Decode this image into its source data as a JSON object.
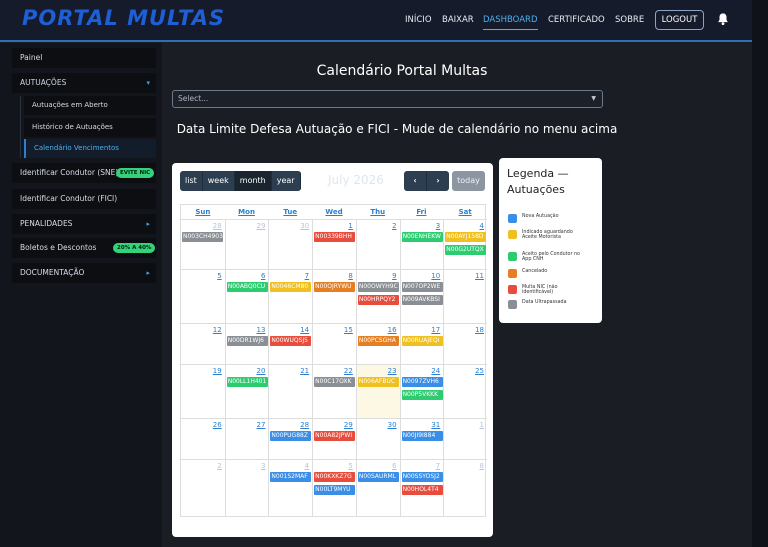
{
  "brand": {
    "logo": "PORTAL MULTAS"
  },
  "nav": {
    "items": [
      "INÍCIO",
      "BAIXAR",
      "DASHBOARD",
      "CERTIFICADO",
      "SOBRE"
    ],
    "logout": "LOGOUT"
  },
  "sidebar": {
    "painel": "Painel",
    "autuacoes": "AUTUAÇÕES",
    "sub": [
      "Autuações em Aberto",
      "Histórico de Autuações",
      "Calendário Vencimentos"
    ],
    "identificar_sne": "Identificar Condutor (SNE)",
    "badge_sne": "EVITE NIC",
    "identificar_fici": "Identificar Condutor (FICI)",
    "penalidades": "PENALIDADES",
    "boletos": "Boletos e Descontos",
    "badge_boletos": "20% A 40%",
    "documentacao": "DOCUMENTAÇÃO"
  },
  "main": {
    "title": "Calendário Portal Multas",
    "select_placeholder": "Select...",
    "subtitle": "Data Limite Defesa Autuação e FICI - Mude de calendário no menu acima"
  },
  "calendar": {
    "views": [
      "list",
      "week",
      "month",
      "year"
    ],
    "active_view": "month",
    "title": "July 2026",
    "today_label": "today",
    "dow": [
      "Sun",
      "Mon",
      "Tue",
      "Wed",
      "Thu",
      "Fri",
      "Sat"
    ],
    "weeks": [
      [
        "28",
        "29",
        "30",
        "1",
        "2",
        "3",
        "4"
      ],
      [
        "5",
        "6",
        "7",
        "8",
        "9",
        "10",
        "11"
      ],
      [
        "12",
        "13",
        "14",
        "15",
        "16",
        "17",
        "18"
      ],
      [
        "19",
        "20",
        "21",
        "22",
        "23",
        "24",
        "25"
      ],
      [
        "26",
        "27",
        "28",
        "29",
        "30",
        "31",
        "1"
      ],
      [
        "2",
        "3",
        "4",
        "5",
        "6",
        "7",
        "8"
      ]
    ],
    "events": [
      {
        "w": 0,
        "d": 0,
        "slot": 0,
        "label": "N003CH4903",
        "color": "gray"
      },
      {
        "w": 0,
        "d": 3,
        "slot": 0,
        "label": "N00339BHH",
        "color": "red"
      },
      {
        "w": 0,
        "d": 5,
        "slot": 0,
        "label": "N00ENHEKW",
        "color": "green"
      },
      {
        "w": 0,
        "d": 6,
        "slot": 0,
        "label": "N00AYJ158D",
        "color": "yellow"
      },
      {
        "w": 0,
        "d": 6,
        "slot": 1,
        "label": "N00G2UTQX",
        "color": "green"
      },
      {
        "w": 1,
        "d": 1,
        "slot": 0,
        "label": "N00ABQ0CU",
        "color": "green"
      },
      {
        "w": 1,
        "d": 2,
        "slot": 0,
        "label": "N0046CM80",
        "color": "yellow"
      },
      {
        "w": 1,
        "d": 3,
        "slot": 0,
        "label": "N00OJRYWU",
        "color": "orange"
      },
      {
        "w": 1,
        "d": 4,
        "slot": 0,
        "label": "N00OWYH9C",
        "color": "gray"
      },
      {
        "w": 1,
        "d": 4,
        "slot": 1,
        "label": "N00HRPQY2",
        "color": "red"
      },
      {
        "w": 1,
        "d": 5,
        "slot": 0,
        "label": "N007OP2WE",
        "color": "gray"
      },
      {
        "w": 1,
        "d": 5,
        "slot": 1,
        "label": "N009AVKBSI",
        "color": "gray"
      },
      {
        "w": 2,
        "d": 1,
        "slot": 0,
        "label": "N00DR1WJ6",
        "color": "gray"
      },
      {
        "w": 2,
        "d": 2,
        "slot": 0,
        "label": "N00WUQSJ5",
        "color": "red"
      },
      {
        "w": 2,
        "d": 4,
        "slot": 0,
        "label": "N00PCSGHA",
        "color": "orange"
      },
      {
        "w": 2,
        "d": 5,
        "slot": 0,
        "label": "N00RUAJEQI",
        "color": "yellow"
      },
      {
        "w": 3,
        "d": 1,
        "slot": 0,
        "label": "N00LL1H401",
        "color": "green"
      },
      {
        "w": 3,
        "d": 3,
        "slot": 0,
        "label": "N00C17OXK",
        "color": "gray"
      },
      {
        "w": 3,
        "d": 4,
        "slot": 0,
        "label": "N006AFBUC",
        "color": "yellow"
      },
      {
        "w": 3,
        "d": 5,
        "slot": 0,
        "label": "N0097ZVH6",
        "color": "blue"
      },
      {
        "w": 3,
        "d": 5,
        "slot": 1,
        "label": "N00P5VKKK",
        "color": "green"
      },
      {
        "w": 4,
        "d": 2,
        "slot": 0,
        "label": "N00PUG88Z",
        "color": "blue"
      },
      {
        "w": 4,
        "d": 3,
        "slot": 0,
        "label": "N00A82JPWI",
        "color": "red"
      },
      {
        "w": 4,
        "d": 5,
        "slot": 0,
        "label": "N00JI9I884",
        "color": "blue"
      },
      {
        "w": 5,
        "d": 2,
        "slot": 0,
        "label": "N001S2MAF",
        "color": "blue"
      },
      {
        "w": 5,
        "d": 3,
        "slot": 0,
        "label": "N00KXKZ7G",
        "color": "red"
      },
      {
        "w": 5,
        "d": 3,
        "slot": 1,
        "label": "N00LT9MYU",
        "color": "blue"
      },
      {
        "w": 5,
        "d": 4,
        "slot": 0,
        "label": "N00SAURML",
        "color": "blue"
      },
      {
        "w": 5,
        "d": 5,
        "slot": 0,
        "label": "N00SSYOSJ2",
        "color": "blue"
      },
      {
        "w": 5,
        "d": 5,
        "slot": 1,
        "label": "N00HOL4T4",
        "color": "red"
      }
    ]
  },
  "legend": {
    "title": "Legenda — Autuações",
    "items": [
      {
        "label": "Nova Autuação",
        "color": "#3a8ee6"
      },
      {
        "label": "Indicado aguardando Aceite Motorista",
        "color": "#f0c020"
      },
      {
        "label": "Aceito pelo Condutor no App CNH",
        "color": "#2ecc71"
      },
      {
        "label": "Cancelado",
        "color": "#e67e22"
      },
      {
        "label": "Multa NIC (não identificável)",
        "color": "#e74c3c"
      },
      {
        "label": "Data Ultrapassada",
        "color": "#8a8f95"
      }
    ]
  },
  "colors": {
    "blue": "#3a8ee6",
    "yellow": "#f0c020",
    "green": "#2ecc71",
    "orange": "#e67e22",
    "red": "#e74c3c",
    "gray": "#8a8f95"
  }
}
